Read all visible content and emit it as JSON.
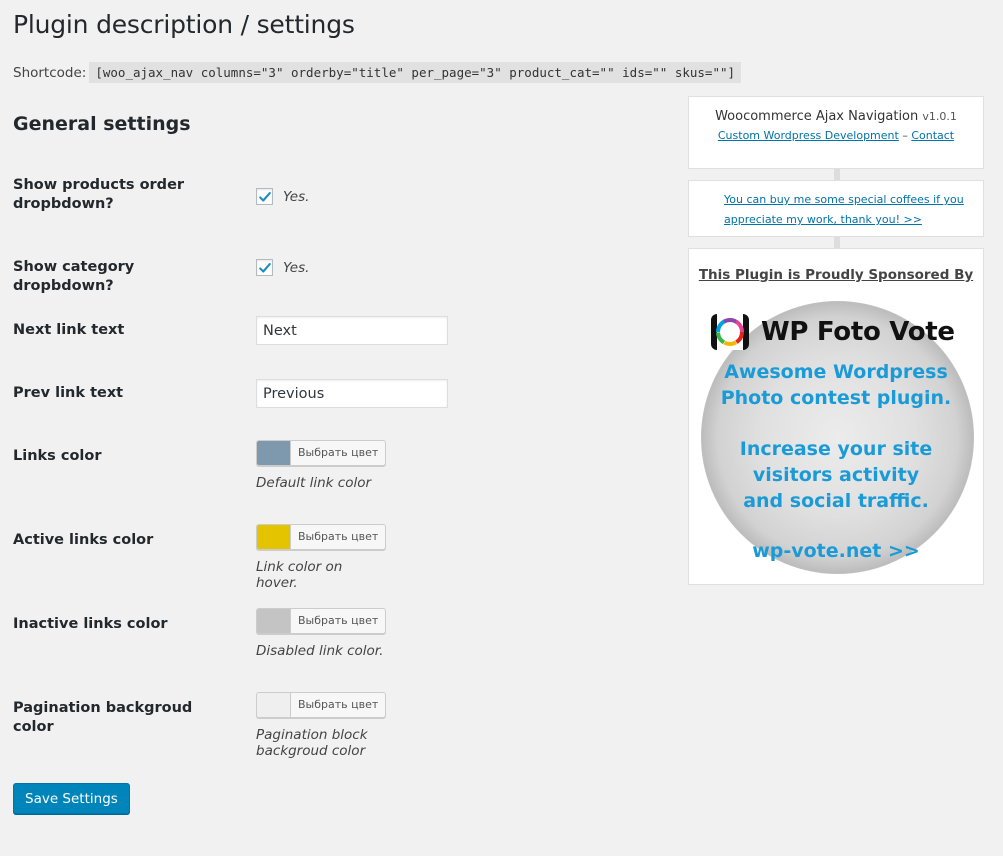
{
  "header": {
    "title": "Plugin description / settings",
    "shortcode_label": "Shortcode:",
    "shortcode_value": "[woo_ajax_nav columns=\"3\" orderby=\"title\" per_page=\"3\" product_cat=\"\" ids=\"\" skus=\"\"]"
  },
  "section": {
    "title": "General settings"
  },
  "settings": {
    "show_order": {
      "label": "Show products order dropbdown?",
      "checked": true,
      "text": "Yes."
    },
    "show_category": {
      "label": "Show category dropbdown?",
      "checked": true,
      "text": "Yes."
    },
    "next_link": {
      "label": "Next link text",
      "value": "Next"
    },
    "prev_link": {
      "label": "Prev link text",
      "value": "Previous"
    },
    "links_color": {
      "label": "Links color",
      "button": "Выбрать цвет",
      "color": "#7e99ae",
      "desc": "Default link color"
    },
    "active_color": {
      "label": "Active links color",
      "button": "Выбрать цвет",
      "color": "#e4c400",
      "desc": "Link color on hover."
    },
    "inactive_color": {
      "label": "Inactive links color",
      "button": "Выбрать цвет",
      "color": "#c4c4c4",
      "desc": "Disabled link color."
    },
    "pagination_bg": {
      "label": "Pagination backgroud color",
      "button": "Выбрать цвет",
      "color": "#efefef",
      "desc": "Pagination block backgroud color"
    }
  },
  "actions": {
    "save_label": "Save Settings"
  },
  "sidebar": {
    "plugin_name": "Woocommerce Ajax Navigation",
    "version": "v1.0.1",
    "link_dev": "Custom Wordpress Development",
    "separator": "–",
    "link_contact": "Contact",
    "coffee_link": "You can buy me some special coffees if you appreciate my work, thank you! >>",
    "sponsor_title": "This Plugin is Proudly Sponsored By",
    "logo_text": "WP Foto Vote",
    "promo_line1": "Awesome Wordpress",
    "promo_line2": "Photo contest plugin.",
    "promo_line3": "Increase your site",
    "promo_line4": "visitors activity",
    "promo_line5": "and social traffic.",
    "promo_url": "wp-vote.net >>"
  },
  "colors": {
    "accent": "#0085ba",
    "link": "#0073aa",
    "promo": "#1a9bd7"
  },
  "icons": {
    "check": "check-icon",
    "logo": "camera-lens-icon"
  }
}
